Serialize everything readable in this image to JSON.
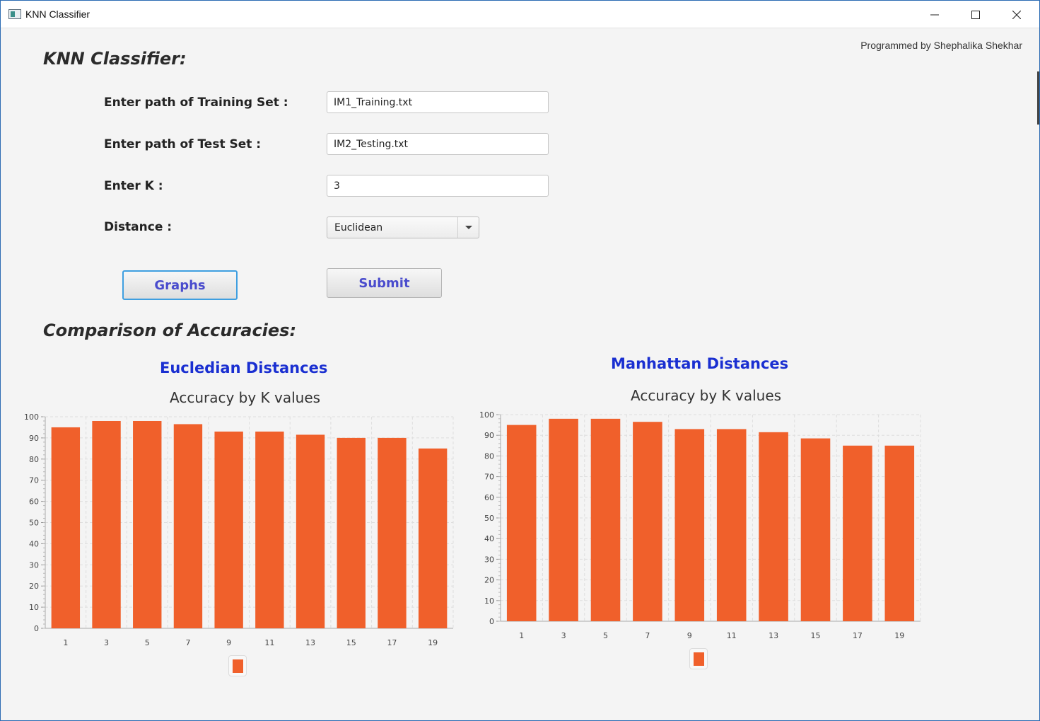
{
  "window": {
    "title": "KNN Classifier"
  },
  "credit": "Programmed by Shephalika Shekhar",
  "heading": "KNN Classifier:",
  "form": {
    "training_label": "Enter path of Training Set :",
    "training_value": "IM1_Training.txt",
    "test_label": "Enter path of Test Set :",
    "test_value": "IM2_Testing.txt",
    "k_label": "Enter K :",
    "k_value": "3",
    "distance_label": "Distance :",
    "distance_value": "Euclidean"
  },
  "buttons": {
    "graphs": "Graphs",
    "submit": "Submit"
  },
  "comparison_heading": "Comparison of Accuracies:",
  "colors": {
    "bar": "#f0602b",
    "heading_blue": "#1a2fd1",
    "button_text": "#4a4ccd"
  },
  "chart_data": [
    {
      "type": "bar",
      "heading": "Eucledian Distances",
      "title": "Accuracy by K values",
      "categories": [
        "1",
        "3",
        "5",
        "7",
        "9",
        "11",
        "13",
        "15",
        "17",
        "19"
      ],
      "values": [
        95,
        98,
        98,
        96.5,
        93,
        93,
        91.5,
        90,
        90,
        85
      ],
      "ylim": [
        0,
        100
      ],
      "yticks": [
        "0",
        "10",
        "20",
        "30",
        "40",
        "50",
        "60",
        "70",
        "80",
        "90",
        "100"
      ],
      "grid": true,
      "legend": "bottom"
    },
    {
      "type": "bar",
      "heading": "Manhattan Distances",
      "title": "Accuracy by K values",
      "categories": [
        "1",
        "3",
        "5",
        "7",
        "9",
        "11",
        "13",
        "15",
        "17",
        "19"
      ],
      "values": [
        95,
        98,
        98,
        96.5,
        93,
        93,
        91.5,
        88.5,
        85,
        85
      ],
      "ylim": [
        0,
        100
      ],
      "yticks": [
        "0",
        "10",
        "20",
        "30",
        "40",
        "50",
        "60",
        "70",
        "80",
        "90",
        "100"
      ],
      "grid": true,
      "legend": "bottom"
    }
  ]
}
